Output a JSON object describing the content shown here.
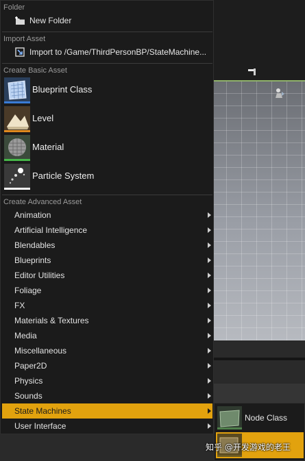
{
  "menu": {
    "folder_header": "Folder",
    "new_folder": {
      "label": "New Folder",
      "icon": "new-folder-icon"
    },
    "import_header": "Import Asset",
    "import": {
      "label": "Import to /Game/ThirdPersonBP/StateMachine...",
      "icon": "import-icon"
    },
    "basic_header": "Create Basic Asset",
    "basic_assets": [
      {
        "label": "Blueprint Class",
        "icon": "blueprint-class-icon",
        "underline_color": "#3a7bd5"
      },
      {
        "label": "Level",
        "icon": "level-icon",
        "underline_color": "#e08a1e"
      },
      {
        "label": "Material",
        "icon": "material-icon",
        "underline_color": "#47b749"
      },
      {
        "label": "Particle System",
        "icon": "particle-system-icon",
        "underline_color": "#ffffff"
      }
    ],
    "advanced_header": "Create Advanced Asset",
    "advanced_items": [
      {
        "label": "Animation"
      },
      {
        "label": "Artificial Intelligence"
      },
      {
        "label": "Blendables"
      },
      {
        "label": "Blueprints"
      },
      {
        "label": "Editor Utilities"
      },
      {
        "label": "Foliage"
      },
      {
        "label": "FX"
      },
      {
        "label": "Materials & Textures"
      },
      {
        "label": "Media"
      },
      {
        "label": "Miscellaneous"
      },
      {
        "label": "Paper2D"
      },
      {
        "label": "Physics"
      },
      {
        "label": "Sounds"
      },
      {
        "label": "State Machines",
        "selected": true
      },
      {
        "label": "User Interface"
      }
    ]
  },
  "submenu": {
    "items": [
      {
        "label": "Node Class",
        "icon": "node-class-icon"
      },
      {
        "label": "",
        "icon": "state-machine-icon",
        "highlighted": true
      }
    ]
  },
  "watermark": "知乎 @开发游戏的老王",
  "colors": {
    "selection": "#e2a20e",
    "menu_bg": "#1b1b1b",
    "horizon": "#8fb26a"
  }
}
